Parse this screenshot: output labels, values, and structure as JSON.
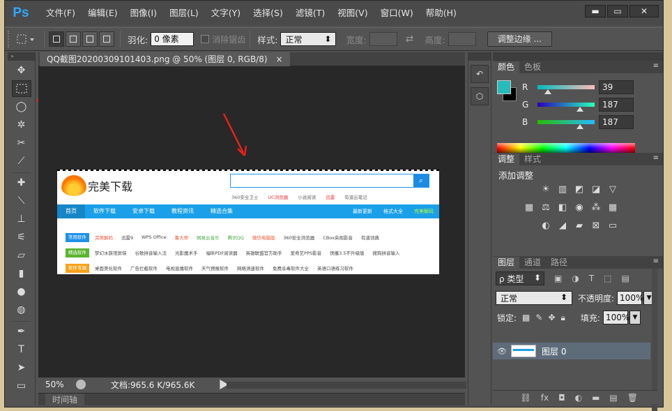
{
  "app": {
    "logo": "Ps",
    "menu": [
      "文件(F)",
      "编辑(E)",
      "图像(I)",
      "图层(L)",
      "文字(Y)",
      "选择(S)",
      "滤镜(T)",
      "视图(V)",
      "窗口(W)",
      "帮助(H)"
    ],
    "window_controls": {
      "minimize": "▬",
      "maximize": "▭",
      "close": "✕"
    }
  },
  "options": {
    "feather_label": "羽化:",
    "feather_value": "0 像素",
    "antialias_label": "消除锯齿",
    "style_label": "样式:",
    "style_value": "正常",
    "width_label": "宽度:",
    "height_label": "高度:",
    "refine_edge": "调整边缘 ..."
  },
  "document": {
    "tab_title": "QQ截图20200309101403.png @ 50% (图层 0, RGB/8)",
    "tab_close": "×",
    "zoom": "50%",
    "doc_info": "文档:965.6 K/965.6K",
    "timeline": "时间轴"
  },
  "screenshot": {
    "logo_text": "完美下载",
    "hot_links": [
      "360安全卫士",
      "UC浏览器",
      "小说阅读",
      "迅雷",
      "有道云笔记"
    ],
    "nav": [
      "首页",
      "软件下载",
      "安卓下载",
      "教程资讯",
      "精选合集"
    ],
    "nav_right": [
      "最新更新",
      "格式大全",
      "完美解码"
    ],
    "rows": [
      {
        "tag": "常用软件",
        "items": [
          "完美解码",
          "迅雷9",
          "WPS Office",
          "鲁大师",
          "网易云音乐",
          "腾讯QQ",
          "微信电脑版",
          "360安全浏览器",
          "CBox央视影音",
          "有道词典"
        ]
      },
      {
        "tag": "精选软件",
        "items": [
          "梦幻水族馆屏保",
          "谷歌拼音输入法",
          "光影魔术手",
          "福昕PDF阅读器",
          "英雄联盟官方助手",
          "爱奇艺PPS影音",
          "快播3.5不升级版",
          "搜狗拼音输入"
        ]
      },
      {
        "tag": "软件专题",
        "items": [
          "桌面美化软件",
          "广告拦截软件",
          "电视直播软件",
          "天气预报软件",
          "网络测速软件",
          "免费杀毒软件大全",
          "英语口语练习软件"
        ]
      }
    ]
  },
  "color_panel": {
    "tabs": [
      "颜色",
      "色板"
    ],
    "fg_color": "#27bbbb",
    "channels": [
      {
        "label": "R",
        "value": "39"
      },
      {
        "label": "G",
        "value": "187"
      },
      {
        "label": "B",
        "value": "187"
      }
    ]
  },
  "adjust_panel": {
    "tabs": [
      "调整",
      "样式"
    ],
    "title": "添加调整"
  },
  "layers_panel": {
    "tabs": [
      "图层",
      "通道",
      "路径"
    ],
    "kind": "ρ 类型",
    "blend": "正常",
    "opacity_label": "不透明度:",
    "opacity_value": "100%",
    "lock_label": "锁定:",
    "fill_label": "填充:",
    "fill_value": "100%",
    "layer_name": "图层 0"
  }
}
